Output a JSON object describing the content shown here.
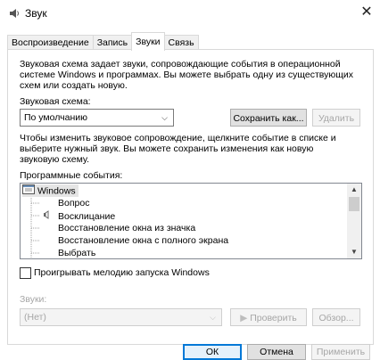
{
  "window": {
    "title": "Звук"
  },
  "tabs": [
    {
      "label": "Воспроизведение"
    },
    {
      "label": "Запись"
    },
    {
      "label": "Звуки"
    },
    {
      "label": "Связь"
    }
  ],
  "intro": {
    "line1": "Звуковая схема задает звуки, сопровождающие события в операционной",
    "line2": "системе Windows и программах. Вы можете выбрать одну из существующих",
    "line3": "схем или создать новую."
  },
  "scheme": {
    "label": "Звуковая схема:",
    "value": "По умолчанию",
    "save_label": "Сохранить как...",
    "delete_label": "Удалить"
  },
  "hint": {
    "line1": "Чтобы изменить звуковое сопровождение, щелкните событие в списке и",
    "line2": "выберите нужный звук. Вы можете сохранить изменения как новую",
    "line3": "звуковую схему."
  },
  "events": {
    "label": "Программные события:",
    "group": "Windows",
    "items": [
      "Вопрос",
      "Восклицание",
      "Восстановление окна из значка",
      "Восстановление окна с полного экрана",
      "Выбрать"
    ]
  },
  "startup": {
    "label": "Проигрывать мелодию запуска Windows",
    "checked": false
  },
  "sounds": {
    "label": "Звуки:",
    "value": "(Нет)",
    "test_label": "Проверить",
    "browse_label": "Обзор..."
  },
  "footer": {
    "ok": "ОК",
    "cancel": "Отмена",
    "apply": "Применить"
  }
}
